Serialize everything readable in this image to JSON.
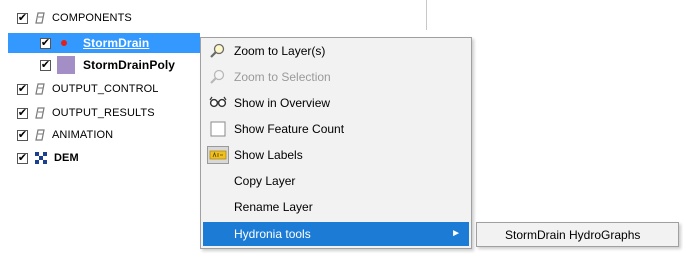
{
  "tree": {
    "items": [
      {
        "label": "COMPONENTS",
        "checked": "✔",
        "icon": "layer-group-icon"
      },
      {
        "label": "StormDrain",
        "checked": "✔",
        "icon": "point-symbol-icon",
        "selected": true
      },
      {
        "label": "StormDrainPoly",
        "checked": "✔",
        "icon": "polygon-symbol-icon"
      },
      {
        "label": "OUTPUT_CONTROL",
        "checked": "✔",
        "icon": "layer-group-icon"
      },
      {
        "label": "OUTPUT_RESULTS",
        "checked": "✔",
        "icon": "layer-group-icon"
      },
      {
        "label": "ANIMATION",
        "checked": "✔",
        "icon": "layer-group-icon"
      },
      {
        "label": "DEM",
        "checked": "✔",
        "icon": "raster-icon"
      }
    ]
  },
  "context_menu": {
    "items": [
      {
        "label": "Zoom to Layer(s)",
        "icon": "zoom-to-layer-icon",
        "enabled": true
      },
      {
        "label": "Zoom to Selection",
        "icon": "zoom-to-selection-icon",
        "enabled": false
      },
      {
        "label": "Show in Overview",
        "icon": "overview-icon",
        "enabled": true
      },
      {
        "label": "Show Feature Count",
        "icon": "feature-count-checkbox-icon",
        "enabled": true
      },
      {
        "label": "Show Labels",
        "icon": "labels-icon",
        "enabled": true
      },
      {
        "label": "Copy Layer",
        "enabled": true
      },
      {
        "label": "Rename Layer",
        "enabled": true
      },
      {
        "label": "Hydronia tools",
        "highlighted": true,
        "submenu_arrow": "►"
      }
    ]
  },
  "submenu": {
    "items": [
      {
        "label": "StormDrain HydroGraphs"
      }
    ]
  },
  "colors": {
    "selection": "#3399ff",
    "menu_highlight": "#1c7cd5",
    "point_symbol": "#e0201c",
    "polygon_symbol": "#a38fc6"
  }
}
